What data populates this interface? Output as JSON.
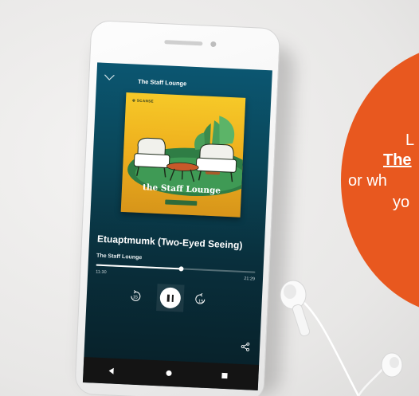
{
  "player": {
    "header_title": "The Staff Lounge",
    "cover": {
      "brand": "⊕ SCANSE",
      "title": "the Staff Lounge"
    },
    "track": {
      "title": "Etuaptmumk (Two-Eyed Seeing)",
      "artist": "The Staff Lounge"
    },
    "progress": {
      "fraction": 0.535,
      "elapsed": "11:30",
      "total": "21:29"
    },
    "controls": {
      "skip_back_label": "15",
      "skip_forward_label": "15"
    },
    "icons": {
      "collapse": "chevron-down-icon",
      "skip_back": "skip-back-15-icon",
      "pause": "pause-icon",
      "skip_forward": "skip-forward-15-icon",
      "share": "share-icon",
      "nav_back": "triangle-back-icon",
      "nav_home": "circle-home-icon",
      "nav_recents": "square-recents-icon"
    }
  },
  "promo": {
    "line1": "L",
    "line2": "The",
    "line3": "or wh",
    "line4": "yo",
    "color": "#e8581f"
  },
  "colors": {
    "screen_top": "#0b5671",
    "screen_bottom": "#081f27",
    "cover_yellow": "#f6c928"
  }
}
